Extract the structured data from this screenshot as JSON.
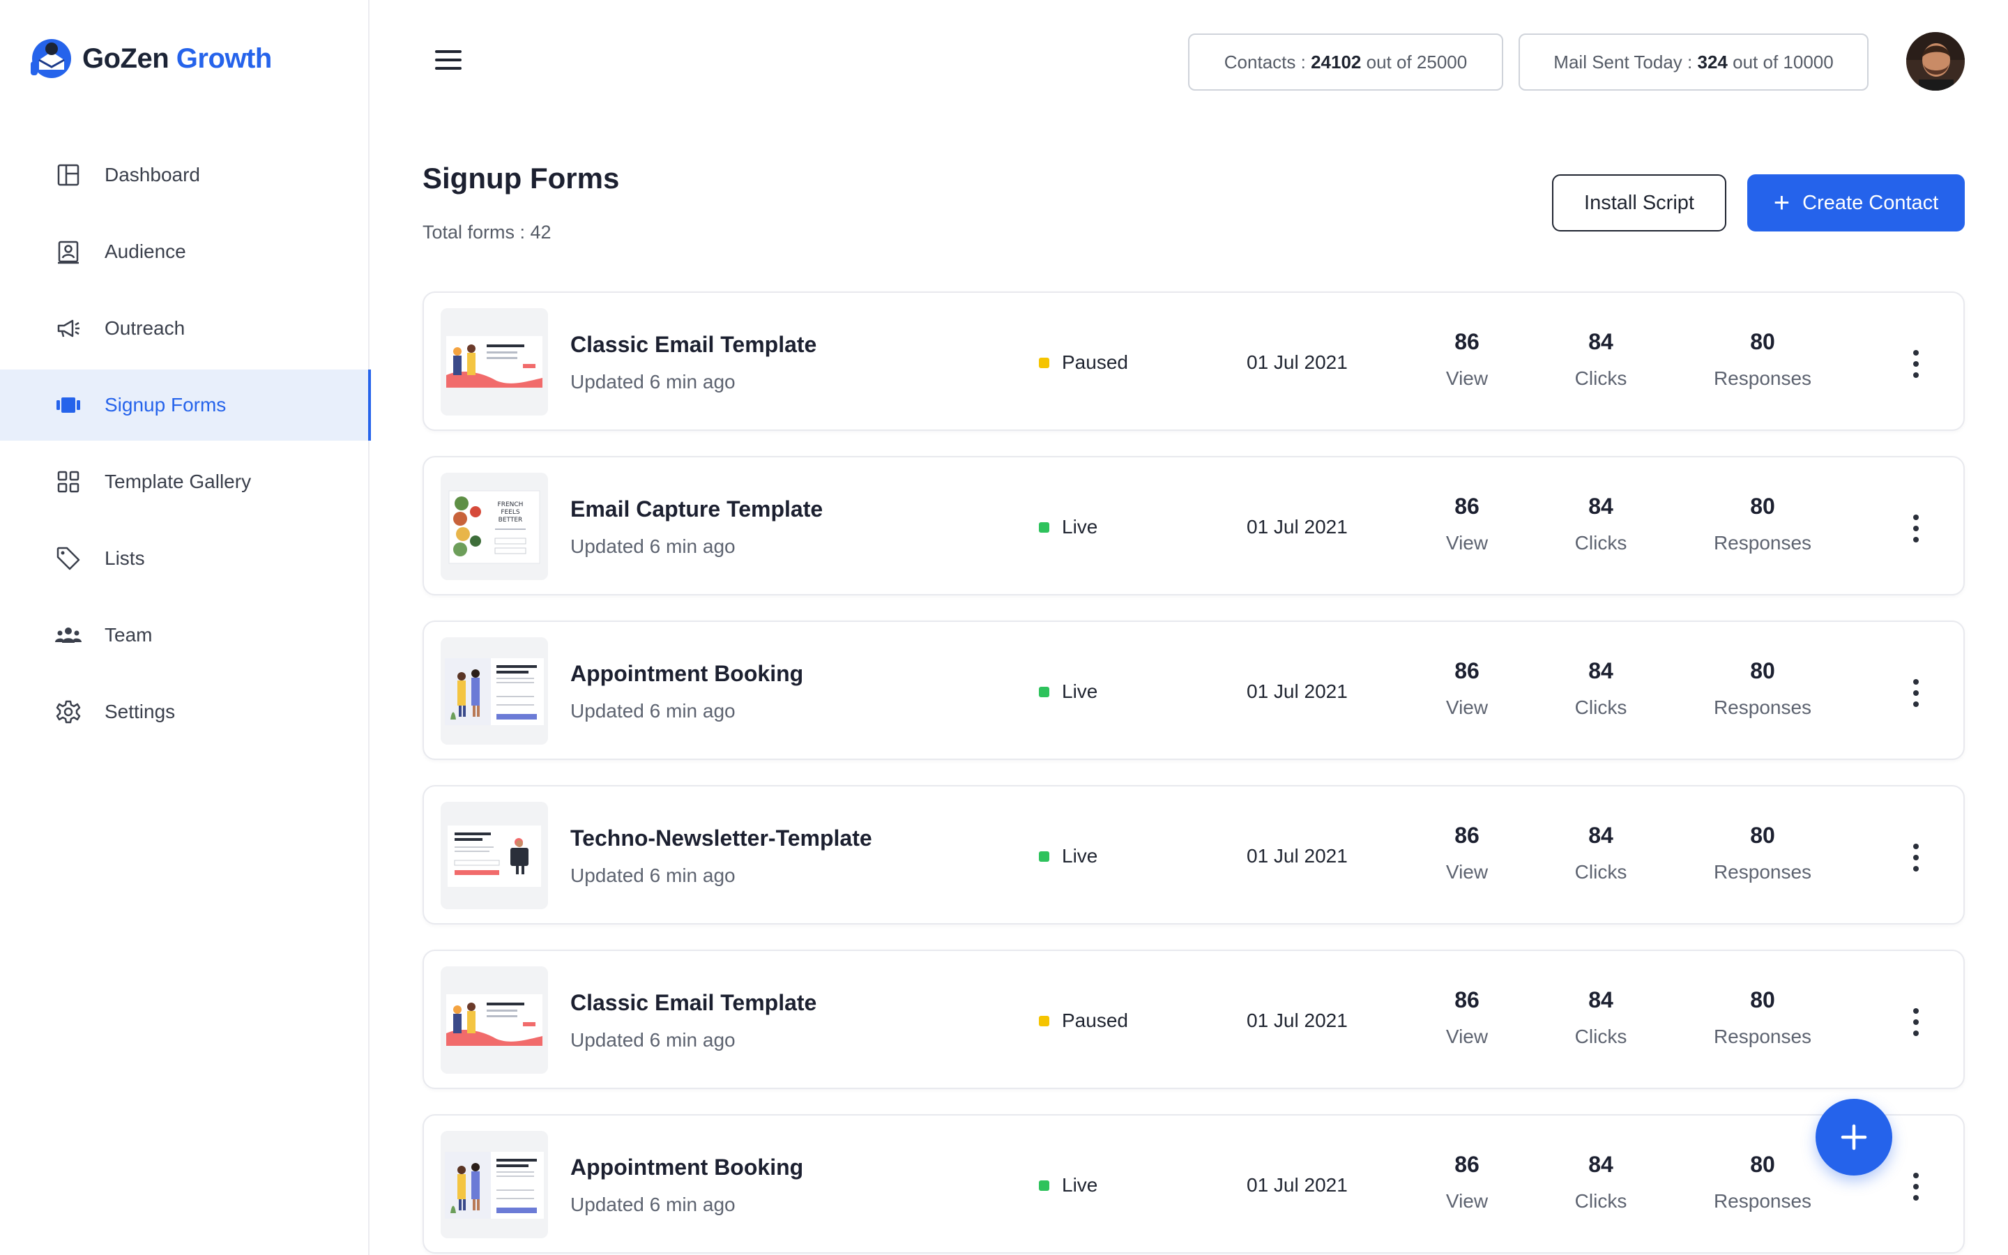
{
  "app": {
    "brand_part1": "GoZen",
    "brand_part2": "Growth",
    "brand_color": "#2563eb"
  },
  "sidebar": {
    "items": [
      {
        "label": "Dashboard",
        "icon": "dashboard-icon",
        "active": false
      },
      {
        "label": "Audience",
        "icon": "audience-icon",
        "active": false
      },
      {
        "label": "Outreach",
        "icon": "megaphone-icon",
        "active": false
      },
      {
        "label": "Signup Forms",
        "icon": "signup-forms-icon",
        "active": true
      },
      {
        "label": "Template Gallery",
        "icon": "grid-icon",
        "active": false
      },
      {
        "label": "Lists",
        "icon": "tag-icon",
        "active": false
      },
      {
        "label": "Team",
        "icon": "team-icon",
        "active": false
      },
      {
        "label": "Settings",
        "icon": "gear-icon",
        "active": false
      }
    ]
  },
  "header": {
    "contacts_label": "Contacts :",
    "contacts_value": "24102",
    "contacts_suffix": "out of 25000",
    "mail_label": "Mail Sent Today :",
    "mail_value": "324",
    "mail_suffix": "out of 10000"
  },
  "page": {
    "title": "Signup Forms",
    "total": "Total forms : 42",
    "install_label": "Install Script",
    "create_label": "Create Contact"
  },
  "forms": [
    {
      "title": "Classic Email Template",
      "updated": "Updated 6 min ago",
      "status": "Paused",
      "status_color": "#f5c400",
      "date": "01 Jul 2021",
      "views": "86",
      "views_label": "View",
      "clicks": "84",
      "clicks_label": "Clicks",
      "responses": "80",
      "responses_label": "Responses",
      "thumb": "classic"
    },
    {
      "title": "Email Capture Template",
      "updated": "Updated 6 min ago",
      "status": "Live",
      "status_color": "#2ec25c",
      "date": "01 Jul 2021",
      "views": "86",
      "views_label": "View",
      "clicks": "84",
      "clicks_label": "Clicks",
      "responses": "80",
      "responses_label": "Responses",
      "thumb": "capture"
    },
    {
      "title": "Appointment Booking",
      "updated": "Updated 6 min ago",
      "status": "Live",
      "status_color": "#2ec25c",
      "date": "01 Jul 2021",
      "views": "86",
      "views_label": "View",
      "clicks": "84",
      "clicks_label": "Clicks",
      "responses": "80",
      "responses_label": "Responses",
      "thumb": "appointment"
    },
    {
      "title": "Techno-Newsletter-Template",
      "updated": "Updated 6 min ago",
      "status": "Live",
      "status_color": "#2ec25c",
      "date": "01 Jul 2021",
      "views": "86",
      "views_label": "View",
      "clicks": "84",
      "clicks_label": "Clicks",
      "responses": "80",
      "responses_label": "Responses",
      "thumb": "techno"
    },
    {
      "title": "Classic Email Template",
      "updated": "Updated 6 min ago",
      "status": "Paused",
      "status_color": "#f5c400",
      "date": "01 Jul 2021",
      "views": "86",
      "views_label": "View",
      "clicks": "84",
      "clicks_label": "Clicks",
      "responses": "80",
      "responses_label": "Responses",
      "thumb": "classic"
    },
    {
      "title": "Appointment Booking",
      "updated": "Updated 6 min ago",
      "status": "Live",
      "status_color": "#2ec25c",
      "date": "01 Jul 2021",
      "views": "86",
      "views_label": "View",
      "clicks": "84",
      "clicks_label": "Clicks",
      "responses": "80",
      "responses_label": "Responses",
      "thumb": "appointment"
    }
  ]
}
